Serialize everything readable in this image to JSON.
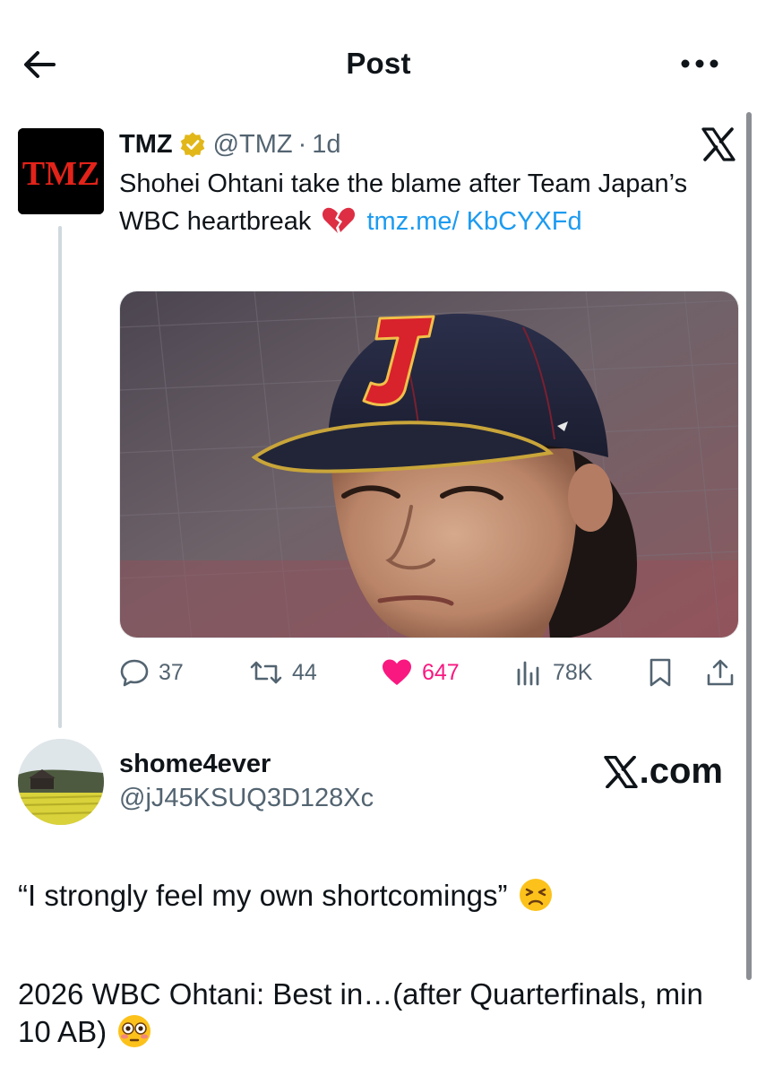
{
  "header": {
    "title": "Post"
  },
  "quoted": {
    "name": "TMZ",
    "handle": "@TMZ",
    "separator": "·",
    "time": "1d",
    "avatar_text": "TMZ",
    "text_part1": "Shohei Ohtani take the blame after Team Japan’s WBC heartbreak",
    "link": "tmz.me/ KbCYXFd",
    "heart_emoji": "broken-heart-emoji",
    "media_desc": "Shohei Ohtani in Team Japan cap"
  },
  "actions": {
    "reply_count": "37",
    "repost_count": "44",
    "like_count": "647",
    "views_count": "78K"
  },
  "author": {
    "name": "shome4ever",
    "handle": "@jJ45KSUQ3D128Xc",
    "watermark": ".com"
  },
  "body": {
    "line1": "“I strongly feel my own shortcomings”",
    "line2": "2026 WBC Ohtani: Best in…(after Quarterfinals, min 10 AB)"
  },
  "colors": {
    "accent": "#1d9bf0",
    "like": "#f91880",
    "muted": "#536471",
    "tmz_red": "#e2231a"
  },
  "icons": [
    "back-arrow-icon",
    "more-icon",
    "verified-icon",
    "x-logo-icon",
    "reply-icon",
    "repost-icon",
    "like-icon",
    "views-icon",
    "bookmark-icon",
    "share-icon"
  ]
}
